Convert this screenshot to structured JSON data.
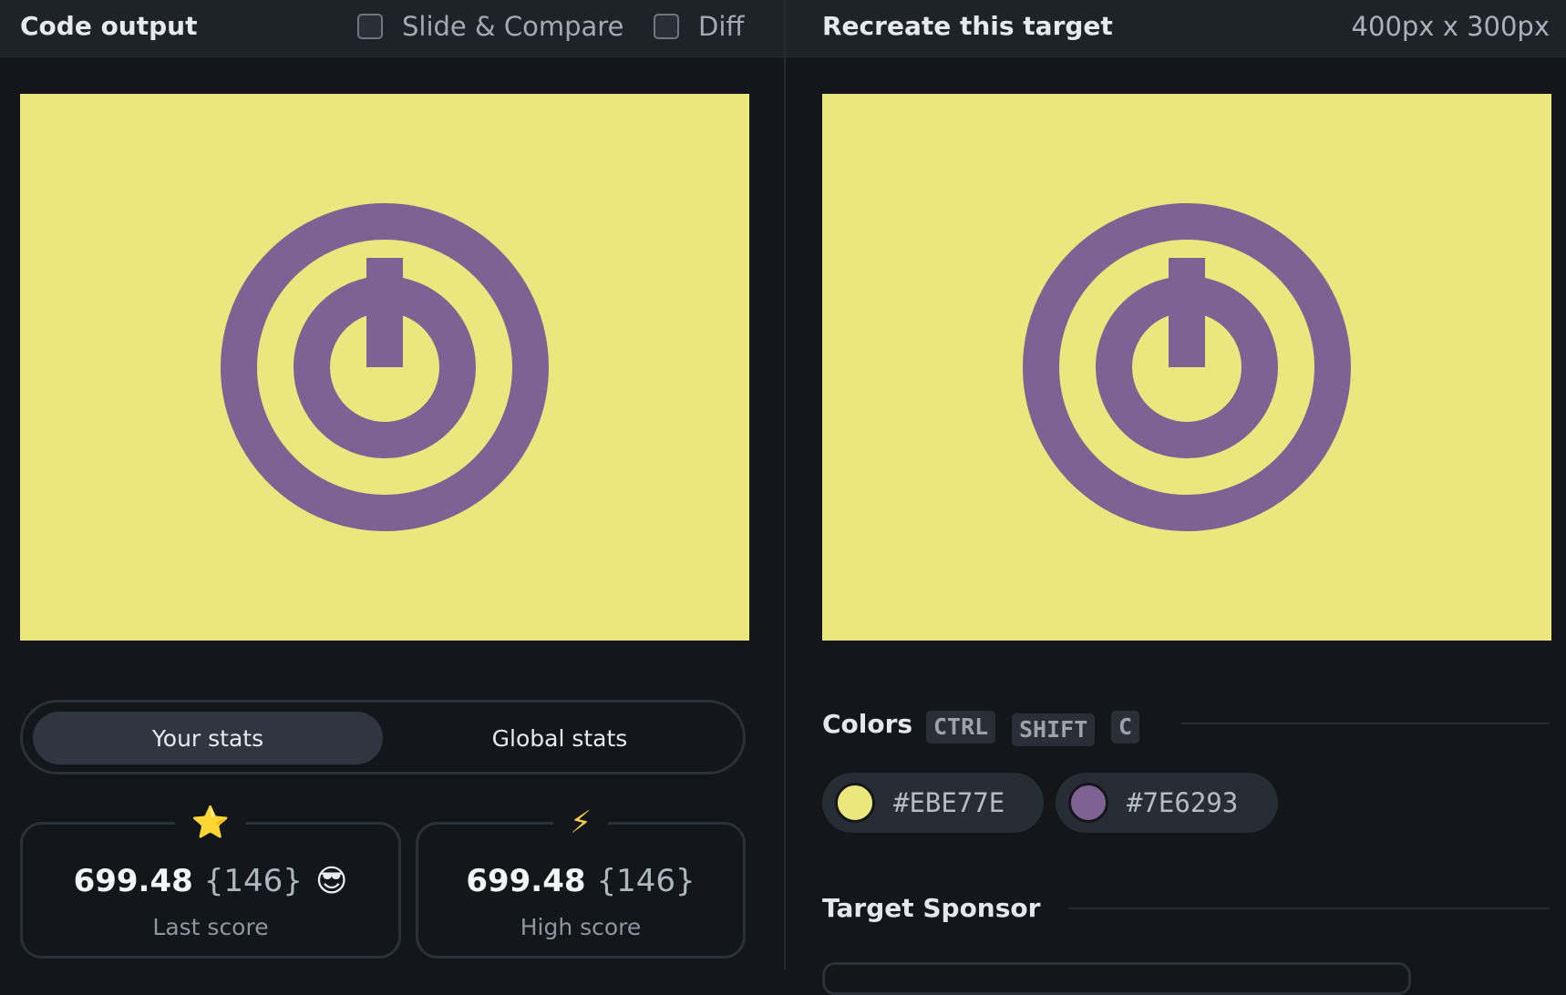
{
  "left": {
    "title": "Code output",
    "slide_compare_label": "Slide & Compare",
    "diff_label": "Diff"
  },
  "right": {
    "title": "Recreate this target",
    "dimensions": "400px x 300px"
  },
  "target": {
    "background": "#EBE77E",
    "foreground": "#7E6293",
    "icon": "power-icon"
  },
  "stats_toggle": {
    "your_stats": "Your stats",
    "global_stats": "Global stats",
    "active": "your_stats"
  },
  "last_score": {
    "icon": "star-icon",
    "icon_char": "⭐",
    "score": "699.48",
    "count": "{146}",
    "emoji": "😎",
    "label": "Last score"
  },
  "high_score": {
    "icon": "lightning-icon",
    "icon_char": "⚡",
    "score": "699.48",
    "count": "{146}",
    "label": "High score"
  },
  "colors": {
    "title": "Colors",
    "shortcut": [
      "CTRL",
      "SHIFT",
      "C"
    ],
    "swatches": [
      {
        "hex": "#EBE77E",
        "label": "#EBE77E"
      },
      {
        "hex": "#7E6293",
        "label": "#7E6293"
      }
    ]
  },
  "sponsor": {
    "title": "Target Sponsor"
  }
}
